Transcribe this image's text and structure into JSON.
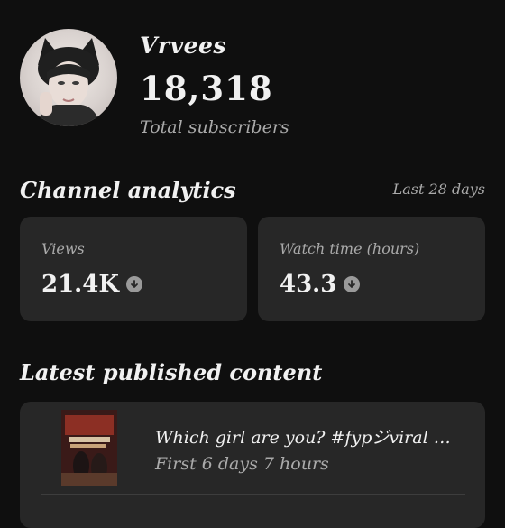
{
  "channel": {
    "name": "Vrvees",
    "subscriber_count": "18,318",
    "subscriber_label": "Total subscribers"
  },
  "analytics": {
    "title": "Channel analytics",
    "range": "Last 28 days",
    "cards": [
      {
        "label": "Views",
        "value": "21.4K",
        "trend_icon": "arrow-down-circle-icon"
      },
      {
        "label": "Watch time (hours)",
        "value": "43.3",
        "trend_icon": "arrow-down-circle-icon"
      }
    ]
  },
  "latest": {
    "title": "Latest published content",
    "video": {
      "title": "Which girl are you? #fypジviral …",
      "meta": "First 6 days 7 hours"
    }
  },
  "colors": {
    "background": "#0f0f0f",
    "card": "#272727",
    "secondary_text": "#aaaaaa"
  }
}
